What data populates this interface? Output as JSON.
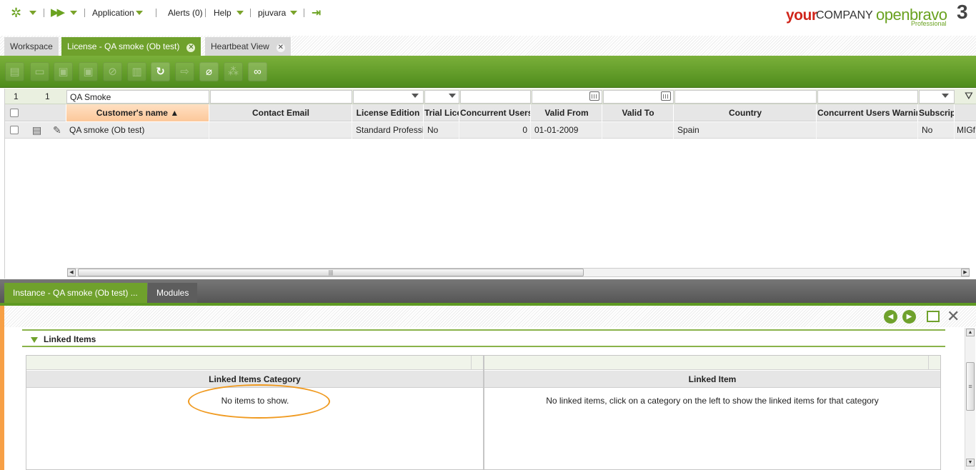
{
  "nav": {
    "application": "Application",
    "alerts": "Alerts (0)",
    "help": "Help",
    "user": "pjuvara"
  },
  "branding": {
    "your": "your",
    "company": "COMPANY",
    "openbravo": "openbravo",
    "version": "3",
    "edition": "Professional"
  },
  "tabs": [
    {
      "label": "Workspace"
    },
    {
      "label": "License - QA smoke (Ob test)"
    },
    {
      "label": "Heartbeat View"
    }
  ],
  "grid": {
    "filter": {
      "row_count": "1",
      "selected_count": "1",
      "customer_name": "QA Smoke"
    },
    "columns": [
      "Customer's name",
      "Contact Email",
      "License Edition",
      "Trial License",
      "Concurrent Users",
      "Valid From",
      "Valid To",
      "Country",
      "Concurrent Users Warning",
      "Subscription",
      ""
    ],
    "sort_indicator": "▲",
    "rows": [
      {
        "customer_name": "QA smoke (Ob test)",
        "contact_email": "",
        "license_edition": "Standard Professional",
        "trial_license": "No",
        "concurrent_users": "0",
        "valid_from": "01-01-2009",
        "valid_to": "",
        "country": "Spain",
        "concurrent_users_warning": "",
        "subscription": "No",
        "extra": "MIGf"
      }
    ]
  },
  "child_tabs": [
    {
      "label": "Instance - QA smoke (Ob test) ..."
    },
    {
      "label": "Modules"
    }
  ],
  "linked_items": {
    "section_title": "Linked Items",
    "category_header": "Linked Items Category",
    "item_header": "Linked Item",
    "category_empty": "No items to show.",
    "item_empty": "No linked items, click on a category on the left to show the linked items for that category"
  },
  "colors": {
    "brand_green": "#6fa12c",
    "accent_orange": "#f7a046",
    "logo_red": "#d0261b"
  }
}
